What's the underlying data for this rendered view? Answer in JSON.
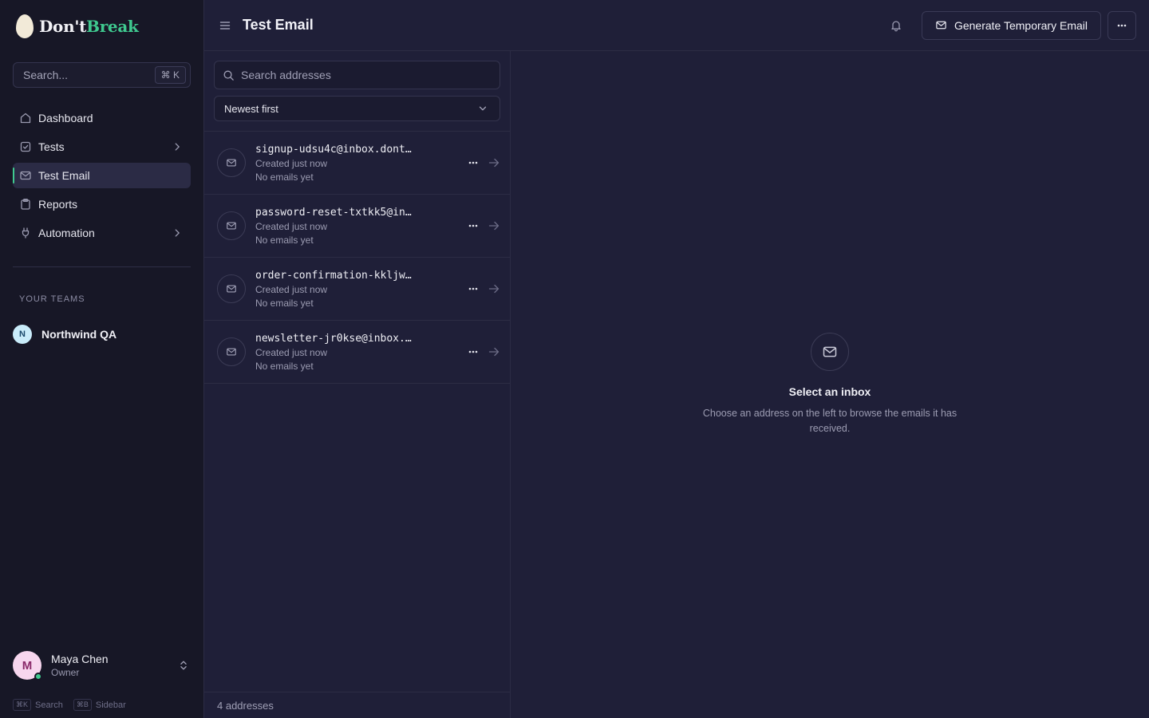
{
  "brand": {
    "name_part1": "Don't",
    "name_part2": "Break"
  },
  "sidebar": {
    "search_placeholder": "Search...",
    "search_shortcut": "⌘ K",
    "items": [
      {
        "label": "Dashboard",
        "icon": "home-icon",
        "has_submenu": false,
        "active": false
      },
      {
        "label": "Tests",
        "icon": "checkbox-icon",
        "has_submenu": true,
        "active": false
      },
      {
        "label": "Test Email",
        "icon": "mail-icon",
        "has_submenu": false,
        "active": true
      },
      {
        "label": "Reports",
        "icon": "clipboard-icon",
        "has_submenu": false,
        "active": false
      },
      {
        "label": "Automation",
        "icon": "plug-icon",
        "has_submenu": true,
        "active": false
      }
    ],
    "teams_title": "YOUR TEAMS",
    "team": {
      "initial": "N",
      "name": "Northwind QA"
    },
    "user": {
      "initial": "M",
      "name": "Maya Chen",
      "role": "Owner"
    },
    "hints": [
      {
        "key": "⌘K",
        "label": "Search"
      },
      {
        "key": "⌘B",
        "label": "Sidebar"
      }
    ]
  },
  "header": {
    "title": "Test Email",
    "generate_label": "Generate Temporary Email"
  },
  "list": {
    "search_placeholder": "Search addresses",
    "sort_selected": "Newest first",
    "addresses": [
      {
        "address": "signup-udsu4c@inbox.dont…",
        "created": "Created just now",
        "status": "No emails yet"
      },
      {
        "address": "password-reset-txtkk5@in…",
        "created": "Created just now",
        "status": "No emails yet"
      },
      {
        "address": "order-confirmation-kkljw…",
        "created": "Created just now",
        "status": "No emails yet"
      },
      {
        "address": "newsletter-jr0kse@inbox.…",
        "created": "Created just now",
        "status": "No emails yet"
      }
    ],
    "footer": "4 addresses"
  },
  "detail": {
    "empty_title": "Select an inbox",
    "empty_desc": "Choose an address on the left to browse the emails it has received."
  },
  "colors": {
    "accent": "#3fc98f",
    "background": "#1f1f38",
    "sidebar_bg": "#171726"
  }
}
